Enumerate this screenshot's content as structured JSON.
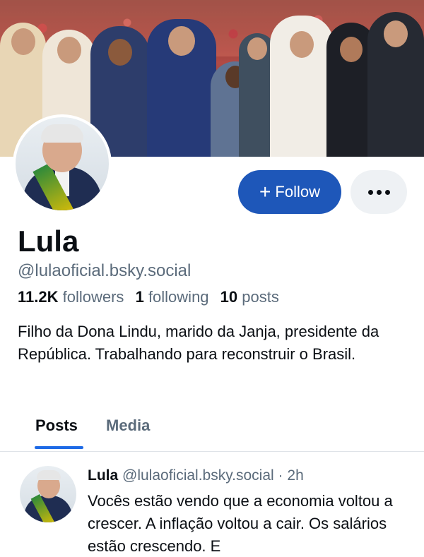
{
  "profile": {
    "display_name": "Lula",
    "handle": "@lulaoficial.bsky.social",
    "followers_count": "11.2K",
    "followers_label": "followers",
    "following_count": "1",
    "following_label": "following",
    "posts_count": "10",
    "posts_label": "posts",
    "bio": "Filho da Dona Lindu, marido da Janja, presidente da República. Trabalhando para reconstruir o Brasil."
  },
  "actions": {
    "follow_icon": "+",
    "follow_label": "Follow",
    "more_icon": "more-dots-icon"
  },
  "tabs": [
    {
      "label": "Posts",
      "active": true
    },
    {
      "label": "Media",
      "active": false
    }
  ],
  "post": {
    "author_name": "Lula",
    "author_handle": "@lulaoficial.bsky.social",
    "separator": "·",
    "time": "2h",
    "text": "Vocês estão vendo que a economia voltou a crescer. A inflação voltou a cair. Os salários estão crescendo. E"
  },
  "colors": {
    "accent": "#1e57b9",
    "tab_underline": "#1e6ae6",
    "muted_text": "#5b6b7b"
  }
}
